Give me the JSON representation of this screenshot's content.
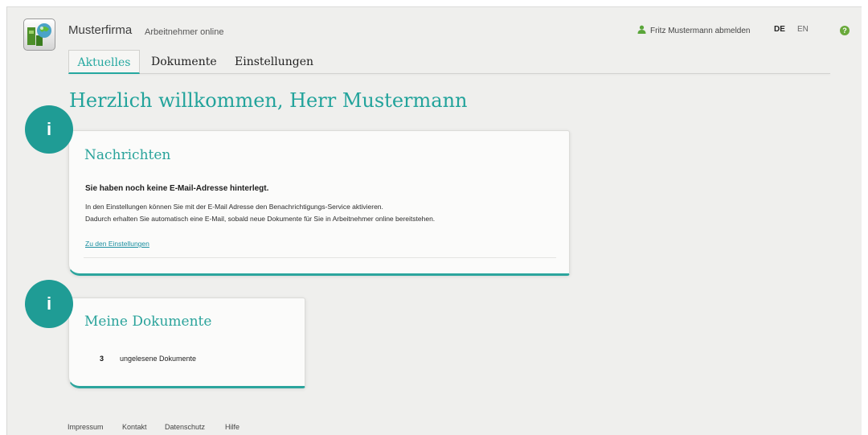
{
  "header": {
    "brand": "Musterfirma",
    "product": "Arbeitnehmer online",
    "logout_text": "Fritz Mustermann abmelden",
    "lang_de": "DE",
    "lang_en": "EN",
    "help_glyph": "?",
    "icons": [
      "app-logo-icon",
      "user-icon",
      "help-icon"
    ]
  },
  "nav": {
    "tabs": [
      {
        "label": "Aktuelles",
        "active": true
      },
      {
        "label": "Dokumente",
        "active": false
      },
      {
        "label": "Einstellungen",
        "active": false
      }
    ]
  },
  "main": {
    "title": "Herzlich willkommen, Herr Mustermann",
    "info_glyph": "i",
    "messages": {
      "title": "Nachrichten",
      "bold": "Sie haben noch keine E-Mail-Adresse hinterlegt.",
      "line1": "In den Einstellungen können Sie mit der E-Mail Adresse den Benachrichtigungs-Service aktivieren.",
      "line2": "Dadurch erhalten Sie automatisch eine E-Mail, sobald neue Dokumente für Sie in Arbeitnehmer online bereitstehen.",
      "link": "Zu den Einstellungen"
    },
    "documents": {
      "title": "Meine Dokumente",
      "count": "3",
      "label": "ungelesene Dokumente"
    }
  },
  "footer": {
    "links": [
      "Impressum",
      "Kontakt",
      "Datenschutz",
      "Hilfe"
    ]
  },
  "colors": {
    "accent": "#22a39b",
    "circle": "#1f9c95",
    "link": "#1b8fa0",
    "background": "#efefed",
    "help": "#69a93a"
  }
}
